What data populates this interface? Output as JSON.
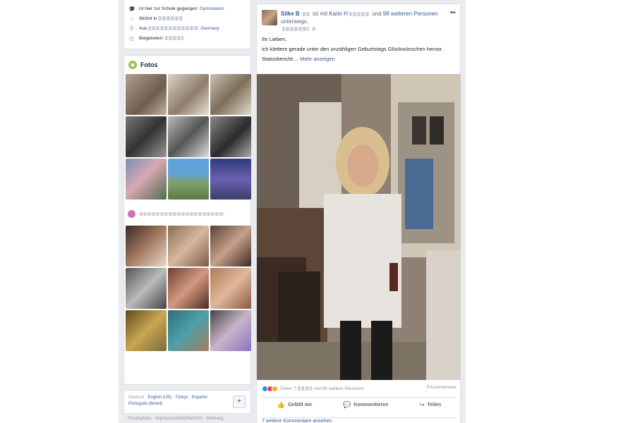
{
  "intro": {
    "school_prefix": "ist hier zur Schule gegangen:",
    "school_name": "Gymnasium",
    "lives_label": "Wohnt in",
    "from_label": "Aus",
    "from_country": "Germany",
    "joined_label": "Beigetreten:"
  },
  "photos": {
    "title": "Fotos"
  },
  "footer": {
    "lang_current": "Deutsch",
    "lang1": "English (US)",
    "lang2": "Türkçe",
    "lang3": "Español",
    "lang4": "Português (Brasil)",
    "add_label": "+",
    "legal": "Privatsphäre · Impressum/AGB/NetzDG · Werbung"
  },
  "post": {
    "author": "Silke B",
    "with_text": "ist mit",
    "tagged": "Karin H",
    "and_text": "und",
    "others": "98 weiteren Personen",
    "suffix": "unterwegs.",
    "greeting": "Ihr Lieben,",
    "body": "ich klettere gerade unter den unzähligen Geburtstags Glückwünschen hervor.",
    "status_label": "Statusbericht:...",
    "more_link": "Mehr anzeigen",
    "reactions_text": "Dieter T",
    "reactions_rest": "und 98 weitere Personen",
    "comment_count": "9 Kommentare",
    "like_label": "Gefällt mir",
    "comment_label": "Kommentieren",
    "share_label": "Teilen",
    "more_comments": "7 weitere Kommentare ansehen"
  },
  "colors": {
    "link": "#365899",
    "background": "#e9ebee",
    "photos_icon": "#8fc24a"
  }
}
